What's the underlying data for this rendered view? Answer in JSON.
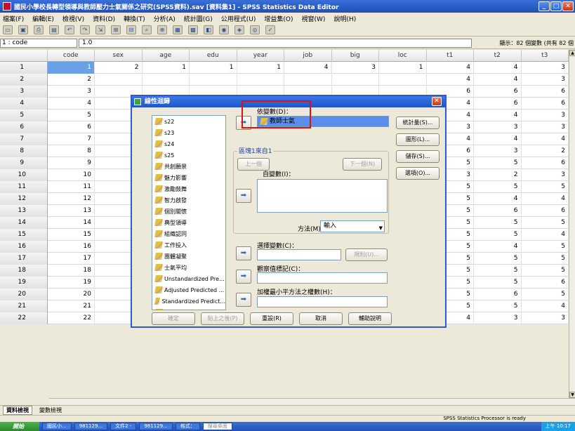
{
  "window": {
    "title": "國民小學校長轉型領導與教師壓力士氣關係之研究(SPSS資料).sav [資料集1] - SPSS Statistics Data Editor",
    "min": "_",
    "max": "□",
    "close": "✕"
  },
  "menu": [
    "檔案(F)",
    "編輯(E)",
    "檢視(V)",
    "資料(D)",
    "轉換(T)",
    "分析(A)",
    "統計圖(G)",
    "公用程式(U)",
    "增益集(O)",
    "視窗(W)",
    "說明(H)"
  ],
  "toolbar": [
    "open-icon",
    "save-icon",
    "print-icon",
    "dialog-recall-icon",
    "undo-icon",
    "redo-icon",
    "goto-case-icon",
    "insert-case-icon",
    "goto-var-icon",
    "find-icon",
    "insert-cases-icon",
    "split-icon",
    "weight-icon",
    "select-icon",
    "value-labels-icon",
    "use-sets-icon",
    "show-all-icon",
    "spell-icon"
  ],
  "cellbar": {
    "ref": "1 : code",
    "value": "1.0",
    "visible": "顯示：82 個變數 (共有 82 個"
  },
  "grid": {
    "columns": [
      "code",
      "sex",
      "age",
      "edu",
      "year",
      "job",
      "big",
      "loc",
      "t1",
      "t2",
      "t3"
    ],
    "rows": [
      {
        "n": "1",
        "v": [
          "1",
          "2",
          "1",
          "1",
          "1",
          "4",
          "3",
          "1",
          "4",
          "4",
          "3"
        ]
      },
      {
        "n": "2",
        "v": [
          "2",
          "",
          "",
          "",
          "",
          "",
          "",
          "",
          "4",
          "4",
          "3"
        ]
      },
      {
        "n": "3",
        "v": [
          "3",
          "",
          "",
          "",
          "",
          "",
          "",
          "",
          "6",
          "6",
          "6"
        ]
      },
      {
        "n": "4",
        "v": [
          "4",
          "",
          "",
          "",
          "",
          "",
          "",
          "",
          "4",
          "6",
          "6"
        ]
      },
      {
        "n": "5",
        "v": [
          "5",
          "",
          "",
          "",
          "",
          "",
          "",
          "",
          "4",
          "4",
          "3"
        ]
      },
      {
        "n": "6",
        "v": [
          "6",
          "",
          "",
          "",
          "",
          "",
          "",
          "",
          "3",
          "3",
          "3"
        ]
      },
      {
        "n": "7",
        "v": [
          "7",
          "",
          "",
          "",
          "",
          "",
          "",
          "",
          "4",
          "4",
          "4"
        ]
      },
      {
        "n": "8",
        "v": [
          "8",
          "",
          "",
          "",
          "",
          "",
          "",
          "",
          "6",
          "3",
          "2"
        ]
      },
      {
        "n": "9",
        "v": [
          "9",
          "",
          "",
          "",
          "",
          "",
          "",
          "",
          "5",
          "5",
          "6"
        ]
      },
      {
        "n": "10",
        "v": [
          "10",
          "",
          "",
          "",
          "",
          "",
          "",
          "",
          "3",
          "2",
          "3"
        ]
      },
      {
        "n": "11",
        "v": [
          "11",
          "",
          "",
          "",
          "",
          "",
          "",
          "",
          "5",
          "5",
          "5"
        ]
      },
      {
        "n": "12",
        "v": [
          "12",
          "",
          "",
          "",
          "",
          "",
          "",
          "",
          "5",
          "4",
          "4"
        ]
      },
      {
        "n": "13",
        "v": [
          "13",
          "",
          "",
          "",
          "",
          "",
          "",
          "",
          "5",
          "6",
          "6"
        ]
      },
      {
        "n": "14",
        "v": [
          "14",
          "",
          "",
          "",
          "",
          "",
          "",
          "",
          "5",
          "5",
          "5"
        ]
      },
      {
        "n": "15",
        "v": [
          "15",
          "",
          "",
          "",
          "",
          "",
          "",
          "",
          "5",
          "5",
          "4"
        ]
      },
      {
        "n": "16",
        "v": [
          "16",
          "",
          "",
          "",
          "",
          "",
          "",
          "",
          "5",
          "4",
          "5"
        ]
      },
      {
        "n": "17",
        "v": [
          "17",
          "",
          "",
          "",
          "",
          "",
          "",
          "",
          "5",
          "5",
          "5"
        ]
      },
      {
        "n": "18",
        "v": [
          "18",
          "",
          "",
          "",
          "",
          "",
          "",
          "",
          "5",
          "5",
          "5"
        ]
      },
      {
        "n": "19",
        "v": [
          "19",
          "",
          "",
          "",
          "",
          "",
          "",
          "",
          "5",
          "5",
          "6"
        ]
      },
      {
        "n": "20",
        "v": [
          "20",
          "2",
          "2",
          "1",
          "1",
          "4",
          "1",
          "3",
          "5",
          "6",
          "5"
        ]
      },
      {
        "n": "21",
        "v": [
          "21",
          "2",
          "3",
          "5",
          "3",
          "1",
          "3",
          "2",
          "5",
          "5",
          "4"
        ]
      },
      {
        "n": "22",
        "v": [
          "22",
          "1",
          "1",
          "4",
          "1",
          "2",
          "3",
          "2",
          "4",
          "3",
          "3"
        ]
      }
    ]
  },
  "sheet_tabs": [
    "資料檢視",
    "變數檢視"
  ],
  "status": "SPSS Statistics Processor is ready",
  "taskbar": {
    "start": "開始",
    "items": [
      "國民小...",
      "981129...",
      "文件2 -",
      "981129...",
      "格式：",
      "搜尋桌面"
    ],
    "clock": "上午 10:17"
  },
  "dialog": {
    "title": "線性迴歸",
    "close": "✕",
    "variables": [
      "s22",
      "s23",
      "s24",
      "s25",
      "共創願景",
      "魅力影響",
      "激勵鼓舞",
      "智力啟發",
      "個別關懷",
      "典型領導",
      "組織認同",
      "工作投入",
      "團體凝聚",
      "士氣平均",
      "Unstandardized Pre...",
      "Adjusted Predicted ...",
      "Standardized Predict...",
      "Standard Error of Pr..."
    ],
    "dependent_label": "依變數(D)：",
    "dependent_value": "教師士氣",
    "block_label": "區塊1來自1",
    "prev_btn": "上一個",
    "next_btn": "下一個(N)",
    "independent_label": "自變數(I)：",
    "method_label": "方法(M)：",
    "method_value": "輸入",
    "selection_label": "選擇變數(C)：",
    "rule_btn": "規則(U)...",
    "case_label": "觀察值標記(C)：",
    "wls_label": "加權最小平方法之權數(H)：",
    "side_buttons": [
      "統計量(S)...",
      "圖形(L)...",
      "儲存(S)...",
      "選項(O)..."
    ],
    "bottom_buttons": [
      "確定",
      "貼上之後(P)",
      "重設(R)",
      "取消",
      "輔助說明"
    ],
    "arrow": "➡"
  }
}
